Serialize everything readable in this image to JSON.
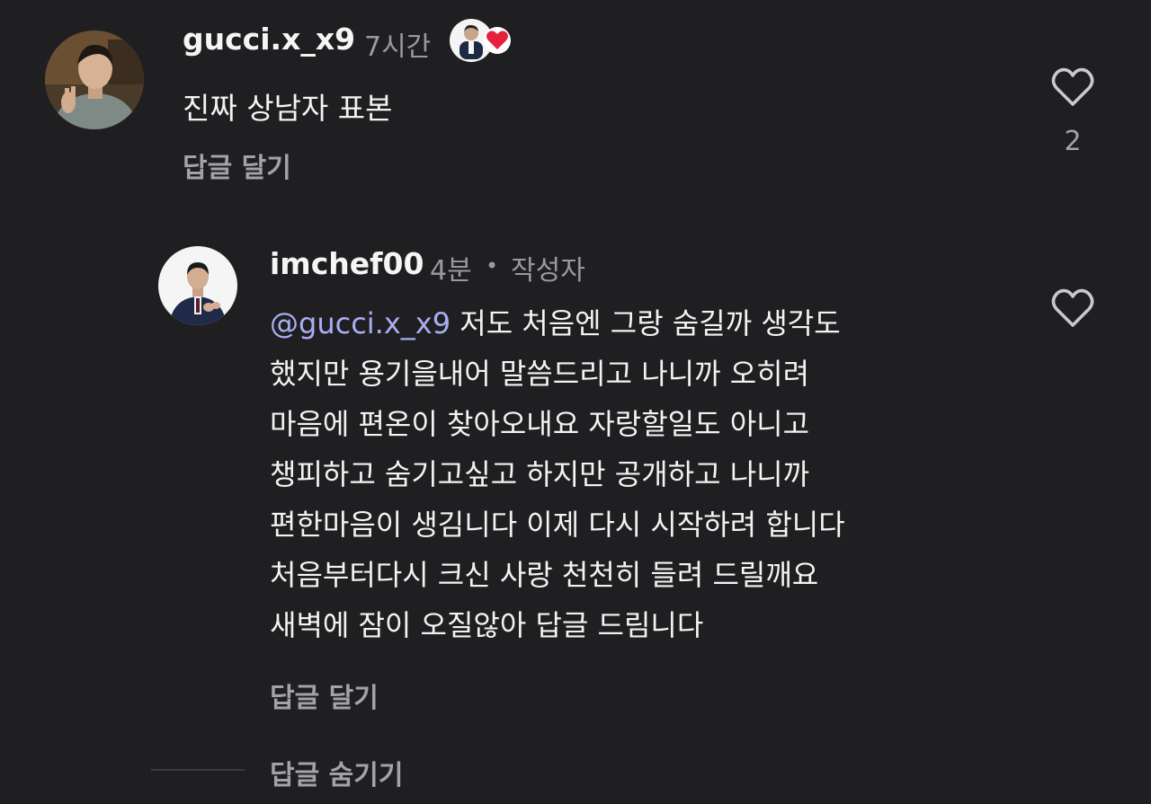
{
  "comment": {
    "username": "gucci.x_x9",
    "time": "7시간",
    "text": "진짜 상남자 표본",
    "reply_action": "답글 달기",
    "like_count": "2"
  },
  "reply": {
    "username": "imchef00",
    "time": "4분",
    "separator": "•",
    "author_label": "작성자",
    "mention": "gucci.x_x9",
    "lines": [
      "저도 처음엔 그랑 숨길까 생각도",
      "했지만 용기을내어 말씀드리고 나니까 오히려",
      "마음에 편온이 찾아오내요  자랑할일도 아니고",
      "챙피하고 숨기고싶고  하지만 공개하고 나니까",
      "편한마음이 생김니다 이제 다시 시작하려 합니다",
      "처음부터다시  크신 사랑 천천히 들려 드릴깨요",
      "새벽에 잠이 오질않아 답글 드림니다"
    ],
    "reply_action": "답글 달기"
  },
  "thread": {
    "hide_replies": "답글 숨기기"
  },
  "colors": {
    "background": "#1f1f21",
    "mention": "#a9aef4",
    "muted": "#9a9a9e",
    "heart_badge": "#e8213b"
  },
  "icons": {
    "like": "heart-outline-icon",
    "mention": "threads-at-icon",
    "badge": "liked-by-author-heart-icon"
  }
}
